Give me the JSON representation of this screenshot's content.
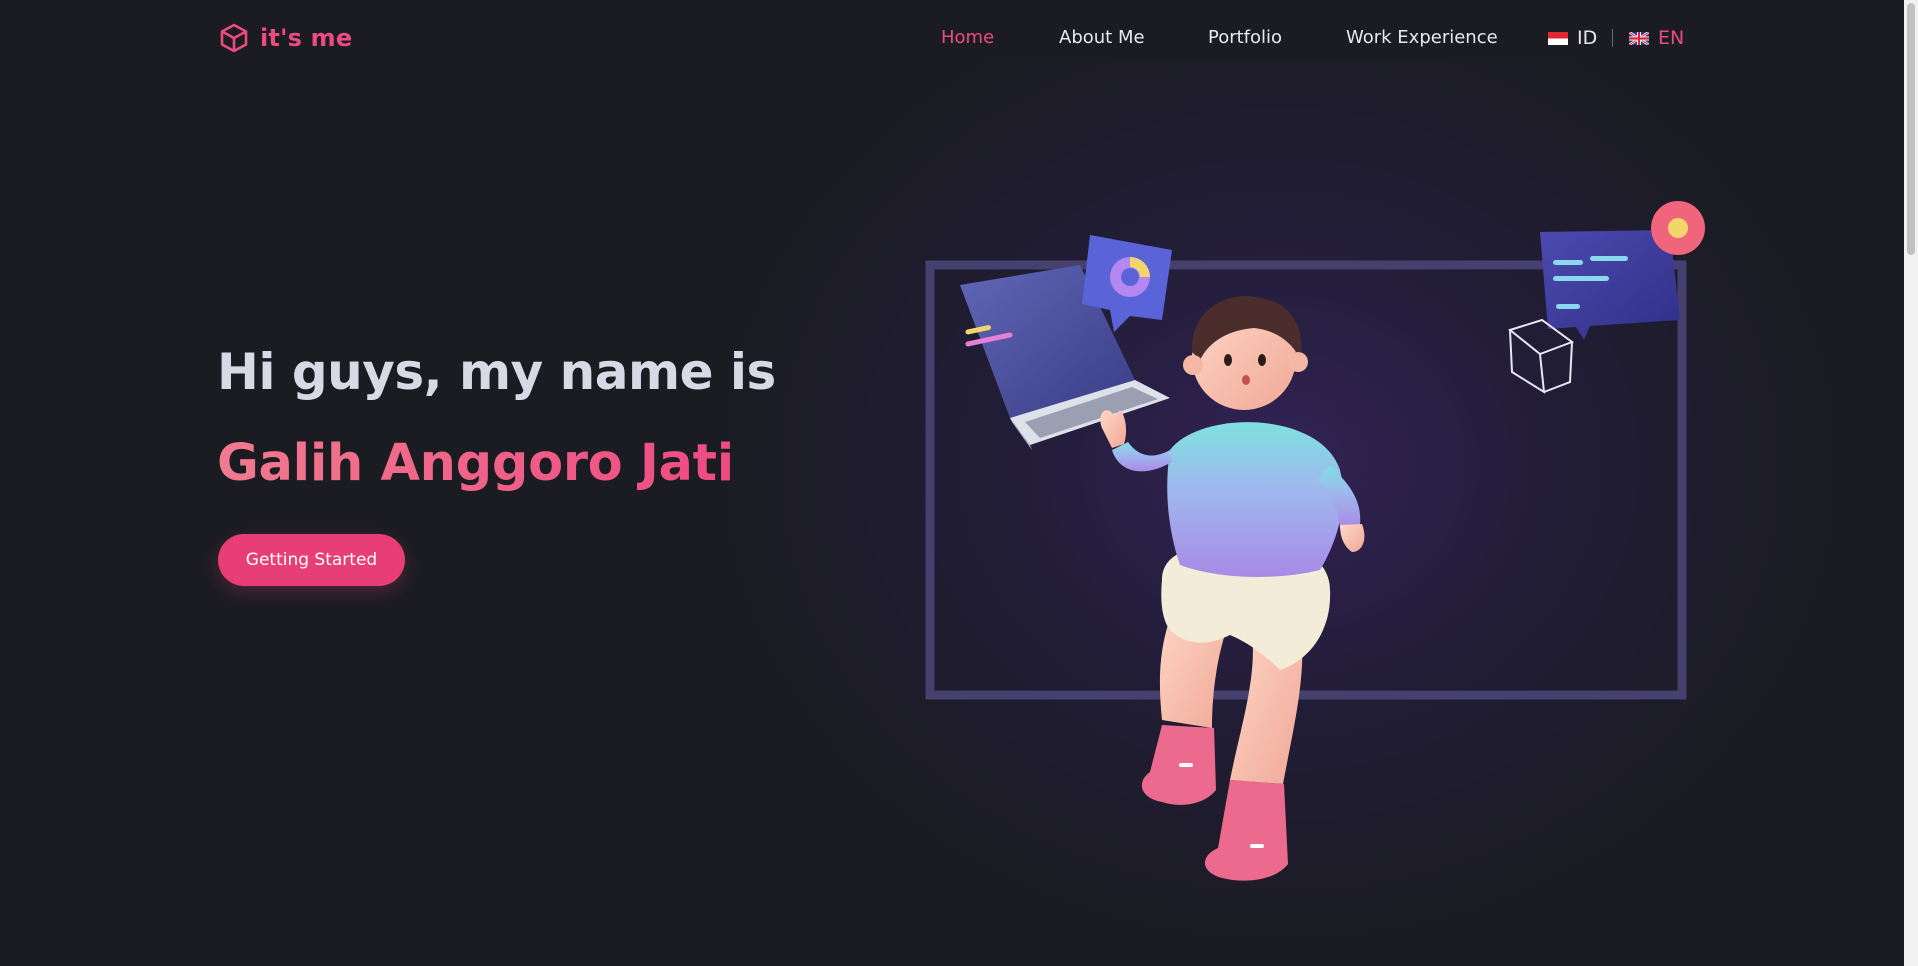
{
  "brand": {
    "name": "it's me",
    "icon": "cube-icon"
  },
  "nav": {
    "items": [
      {
        "label": "Home",
        "active": true
      },
      {
        "label": "About Me",
        "active": false
      },
      {
        "label": "Portfolio",
        "active": false
      },
      {
        "label": "Work Experience",
        "active": false
      }
    ]
  },
  "language": {
    "options": [
      {
        "code": "ID",
        "flag": "indonesia-flag-icon",
        "active": false
      },
      {
        "code": "EN",
        "flag": "uk-flag-icon",
        "active": true
      }
    ]
  },
  "hero": {
    "greeting": "Hi guys, my name is",
    "name": "Galih Anggoro Jati",
    "cta_label": "Getting Started"
  },
  "colors": {
    "accent": "#ee4a82",
    "background": "#1b1c22",
    "text": "#e8e8ee"
  }
}
